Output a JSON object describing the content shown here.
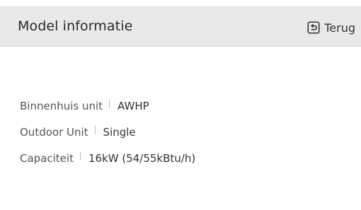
{
  "header": {
    "title": "Model informatie",
    "back_label": "Terug",
    "back_icon": "return-arrow-icon"
  },
  "info": [
    {
      "label": "Binnenhuis unit",
      "value": "AWHP"
    },
    {
      "label": "Outdoor Unit",
      "value": "Single"
    },
    {
      "label": "Capaciteit",
      "value": "16kW (54/55kBtu/h)"
    }
  ],
  "colors": {
    "header_background": "#e9e9e9",
    "background": "#ffffff",
    "text_primary": "#2a2a2a",
    "text_secondary": "#555555"
  }
}
